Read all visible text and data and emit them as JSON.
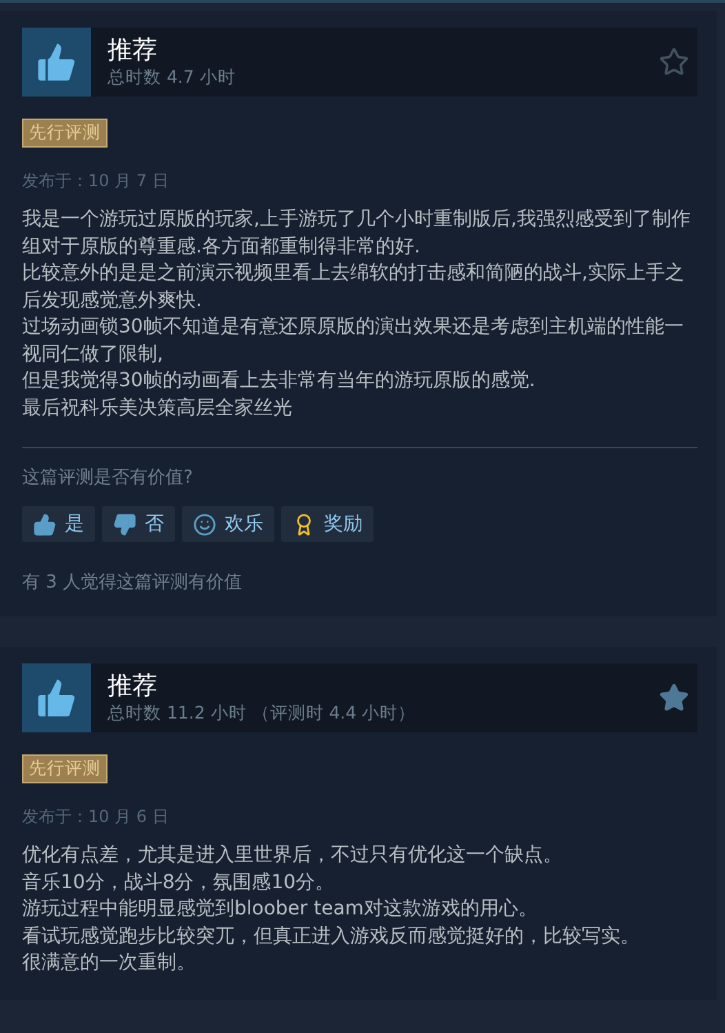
{
  "reviews": [
    {
      "verdict": "推荐",
      "hours": "总时数 4.7 小时",
      "starred": false,
      "badge": "先行评测",
      "posted": "发布于：10 月 7 日",
      "body": [
        "我是一个游玩过原版的玩家,上手游玩了几个小时重制版后,我强烈感受到了制作组对于原版的尊重感.各方面都重制得非常的好.",
        "比较意外的是是之前演示视频里看上去绵软的打击感和简陋的战斗,实际上手之后发现感觉意外爽快.",
        "过场动画锁30帧不知道是有意还原原版的演出效果还是考虑到主机端的性能一视同仁做了限制,",
        "但是我觉得30帧的动画看上去非常有当年的游玩原版的感觉.",
        "最后祝科乐美决策高层全家丝光"
      ],
      "vote": {
        "question": "这篇评测是否有价值?",
        "buttons": [
          {
            "kind": "yes",
            "label": "是"
          },
          {
            "kind": "no",
            "label": "否"
          },
          {
            "kind": "funny",
            "label": "欢乐"
          },
          {
            "kind": "award",
            "label": "奖励"
          }
        ],
        "helpful": "有 3 人觉得这篇评测有价值"
      }
    },
    {
      "verdict": "推荐",
      "hours": "总时数 11.2 小时 （评测时 4.4 小时）",
      "starred": true,
      "badge": "先行评测",
      "posted": "发布于：10 月 6 日",
      "body": [
        "优化有点差，尤其是进入里世界后，不过只有优化这一个缺点。",
        "音乐10分，战斗8分，氛围感10分。",
        "游玩过程中能明显感觉到bloober team对这款游戏的用心。",
        "看试玩感觉跑步比较突兀，但真正进入游戏反而感觉挺好的，比较写实。",
        "很满意的一次重制。"
      ]
    }
  ]
}
